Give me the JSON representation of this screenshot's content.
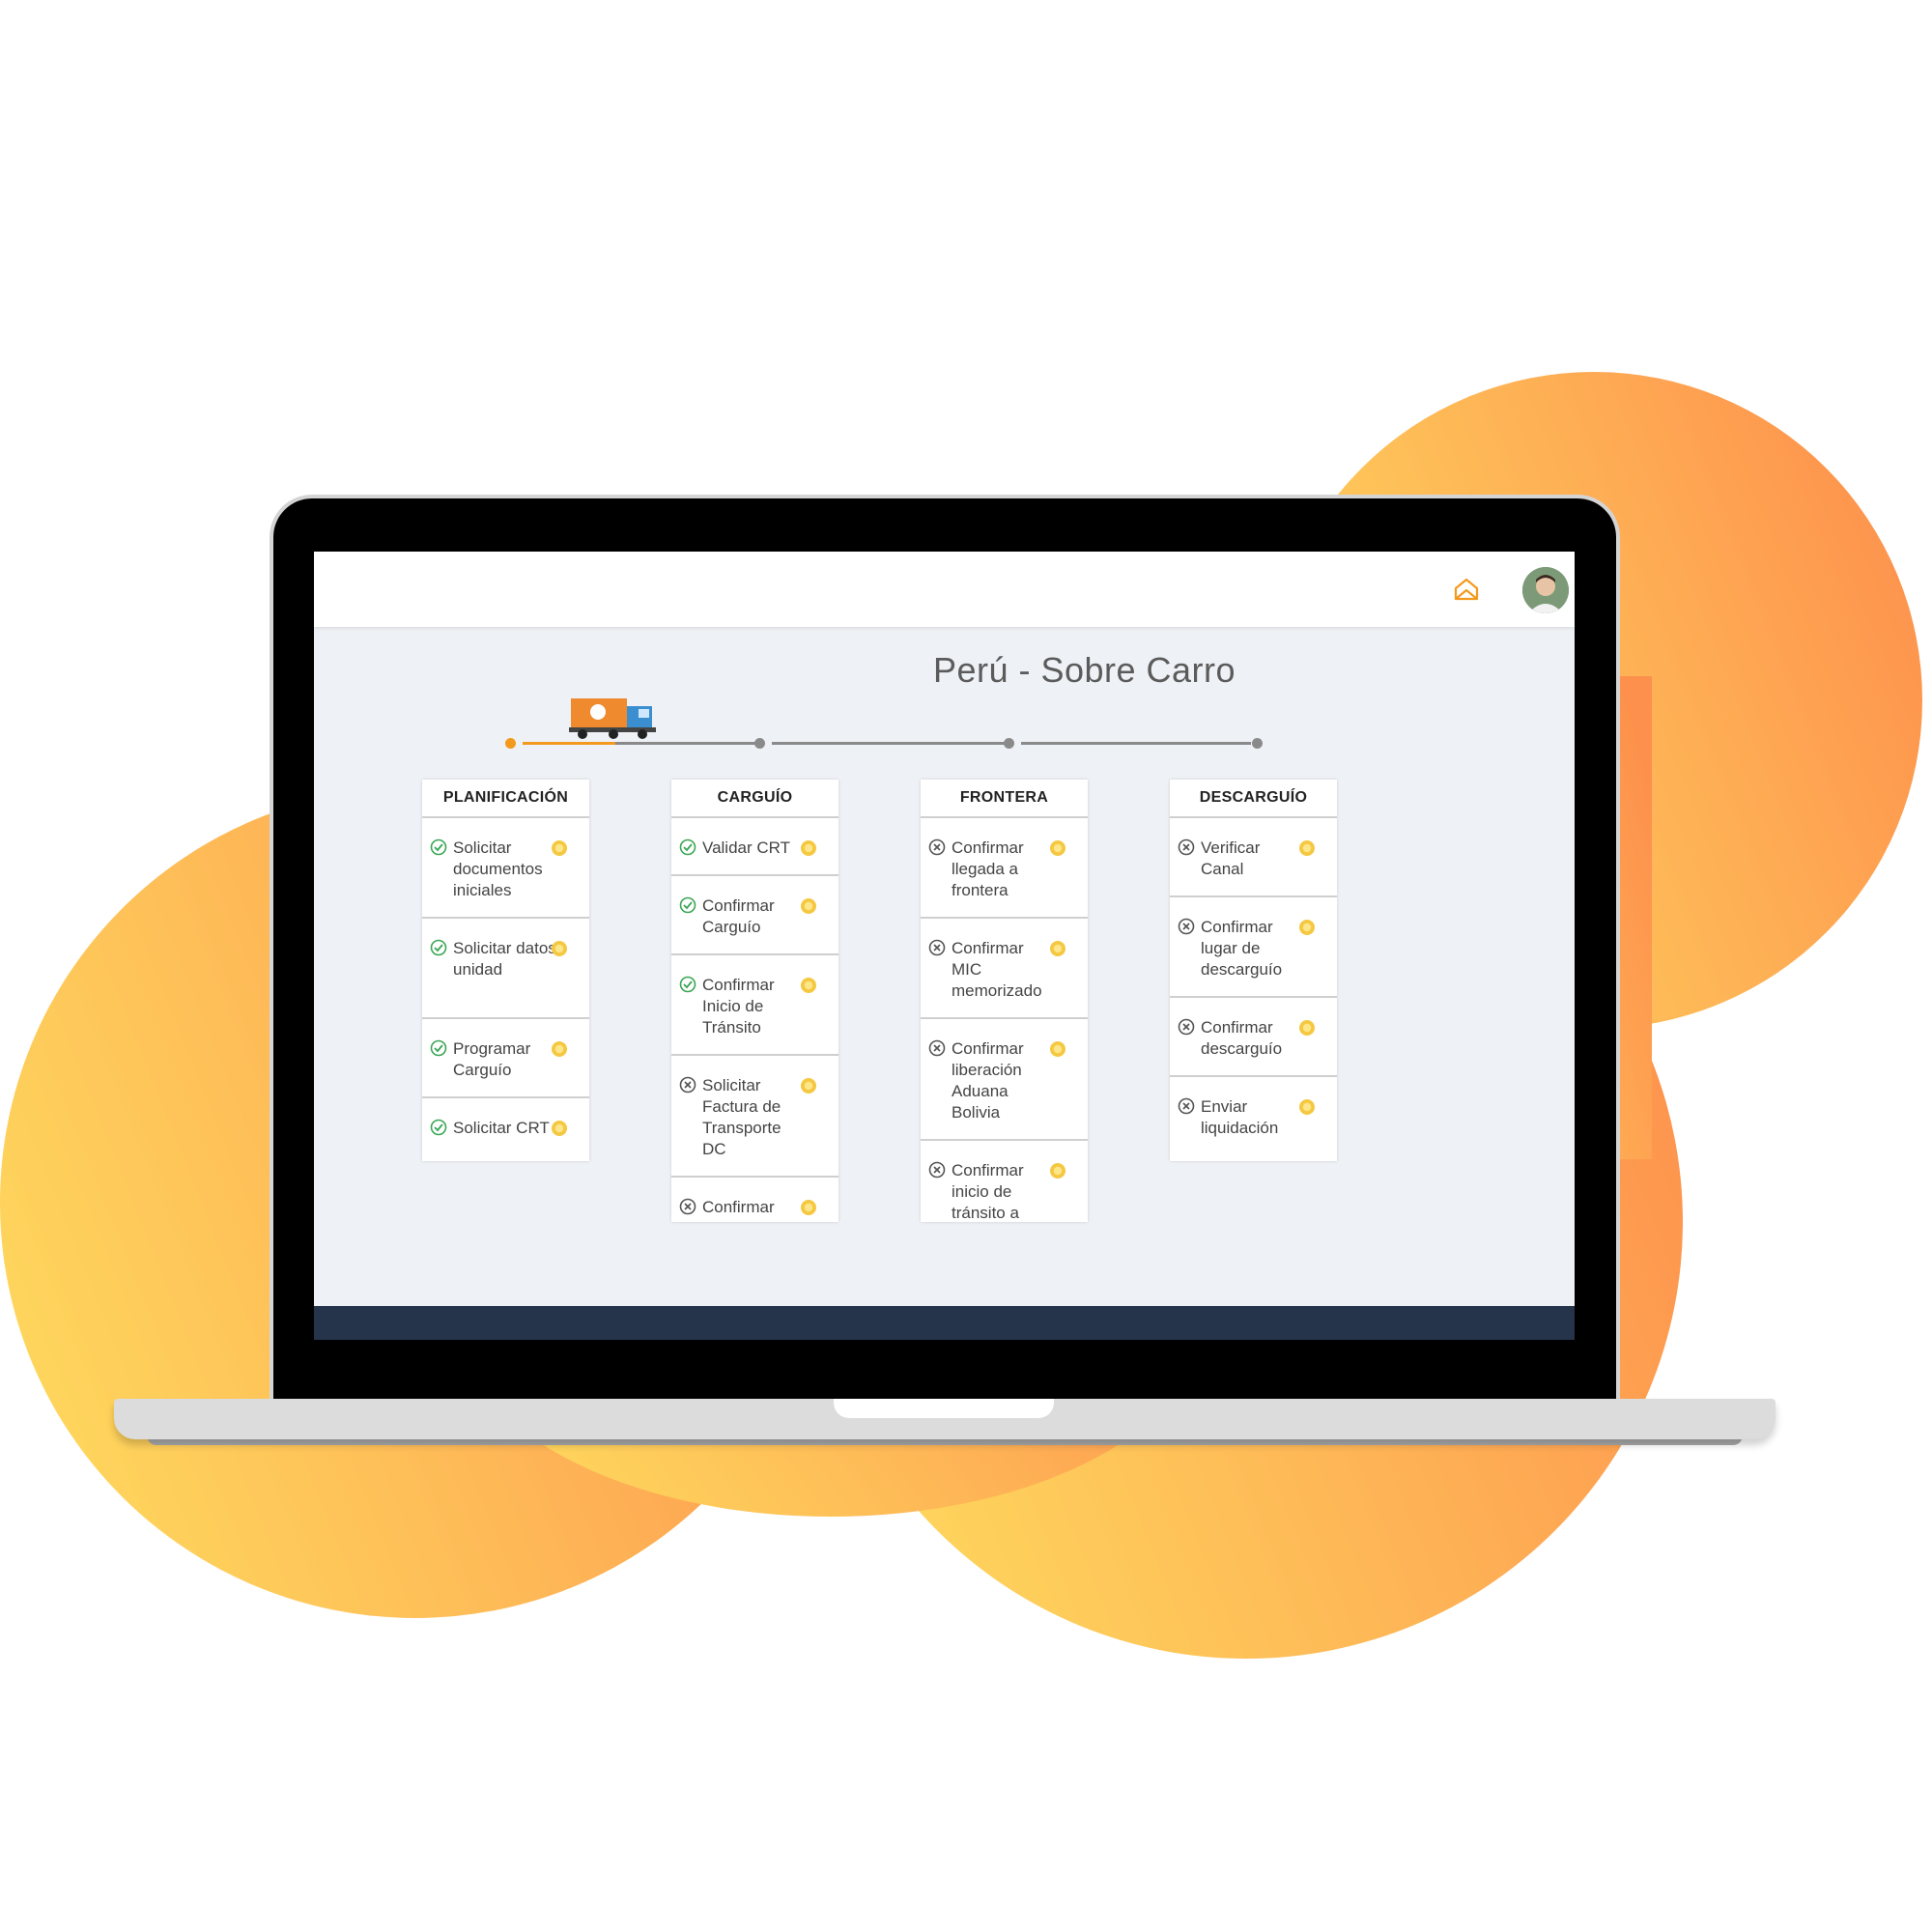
{
  "page_title": "Perú - Sobre Carro",
  "colors": {
    "accent": "#f39a1e",
    "blob_yellow": "#fed55c",
    "blob_orange": "#fd914d",
    "footer": "#25344b",
    "done_status": "#3aa654",
    "pending_status": "#555555"
  },
  "header": {
    "home_icon": "home-icon",
    "avatar": "user-avatar"
  },
  "progress": {
    "stages_count": 4,
    "active_stage": 1,
    "truck_icon": "truck-icon"
  },
  "columns": [
    {
      "title": "PLANIFICACIÓN",
      "tasks": [
        {
          "label": "Solicitar documentos iniciales",
          "status": "done"
        },
        {
          "label": "Solicitar datos unidad",
          "status": "done"
        },
        {
          "label": "Programar Carguío",
          "status": "done"
        },
        {
          "label": "Solicitar CRT",
          "status": "done"
        }
      ]
    },
    {
      "title": "CARGUÍO",
      "tasks": [
        {
          "label": "Validar CRT",
          "status": "done"
        },
        {
          "label": "Confirmar Carguío",
          "status": "done"
        },
        {
          "label": "Confirmar Inicio de Tránsito",
          "status": "done"
        },
        {
          "label": "Solicitar Factura de Transporte DC",
          "status": "pending"
        },
        {
          "label": "Confirmar inicio de",
          "status": "pending"
        }
      ]
    },
    {
      "title": "FRONTERA",
      "tasks": [
        {
          "label": "Confirmar llegada a frontera",
          "status": "pending"
        },
        {
          "label": "Confirmar MIC memorizado",
          "status": "pending"
        },
        {
          "label": "Confirmar liberación Aduana Bolivia",
          "status": "pending"
        },
        {
          "label": "Confirmar inicio de tránsito a",
          "status": "pending"
        }
      ]
    },
    {
      "title": "DESCARGUÍO",
      "tasks": [
        {
          "label": "Verificar Canal",
          "status": "pending"
        },
        {
          "label": "Confirmar lugar de descarguío",
          "status": "pending"
        },
        {
          "label": "Confirmar descarguío",
          "status": "pending"
        },
        {
          "label": "Enviar liquidación",
          "status": "pending"
        }
      ]
    }
  ]
}
